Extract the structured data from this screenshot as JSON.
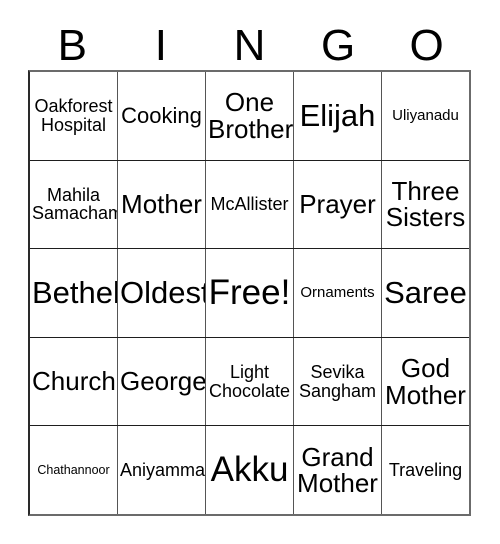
{
  "card": {
    "title": "BINGO Card",
    "header_letters": [
      "B",
      "I",
      "N",
      "G",
      "O"
    ],
    "free_space_label": "Free!",
    "colors": {
      "background": "#ffffff",
      "text": "#000000",
      "grid_line": "#555555",
      "grid_border": "#6b6b6b"
    },
    "rows": [
      [
        {
          "text": "Oakforest\nHospital",
          "size": "sz-m"
        },
        {
          "text": "Cooking",
          "size": "sz-l"
        },
        {
          "text": "One\nBrother",
          "size": "sz-xl"
        },
        {
          "text": "Elijah",
          "size": "sz-xxl"
        },
        {
          "text": "Uliyanadu",
          "size": "sz-s"
        }
      ],
      [
        {
          "text": "Mahila\nSamacham",
          "size": "sz-m"
        },
        {
          "text": "Mother",
          "size": "sz-xl"
        },
        {
          "text": "McAllister",
          "size": "sz-m"
        },
        {
          "text": "Prayer",
          "size": "sz-xl"
        },
        {
          "text": "Three\nSisters",
          "size": "sz-xl"
        }
      ],
      [
        {
          "text": "Bethel",
          "size": "sz-xxl"
        },
        {
          "text": "Oldest",
          "size": "sz-xxl"
        },
        {
          "text": "Free!",
          "size": "sz-huge"
        },
        {
          "text": "Ornaments",
          "size": "sz-s"
        },
        {
          "text": "Saree",
          "size": "sz-xxl"
        }
      ],
      [
        {
          "text": "Church",
          "size": "sz-xl"
        },
        {
          "text": "George",
          "size": "sz-xl"
        },
        {
          "text": "Light\nChocolate",
          "size": "sz-m"
        },
        {
          "text": "Sevika\nSangham",
          "size": "sz-m"
        },
        {
          "text": "God\nMother",
          "size": "sz-xl"
        }
      ],
      [
        {
          "text": "Chathannoor",
          "size": "sz-xs"
        },
        {
          "text": "Aniyamma",
          "size": "sz-m"
        },
        {
          "text": "Akku",
          "size": "sz-huge"
        },
        {
          "text": "Grand\nMother",
          "size": "sz-xl"
        },
        {
          "text": "Traveling",
          "size": "sz-m"
        }
      ]
    ]
  }
}
